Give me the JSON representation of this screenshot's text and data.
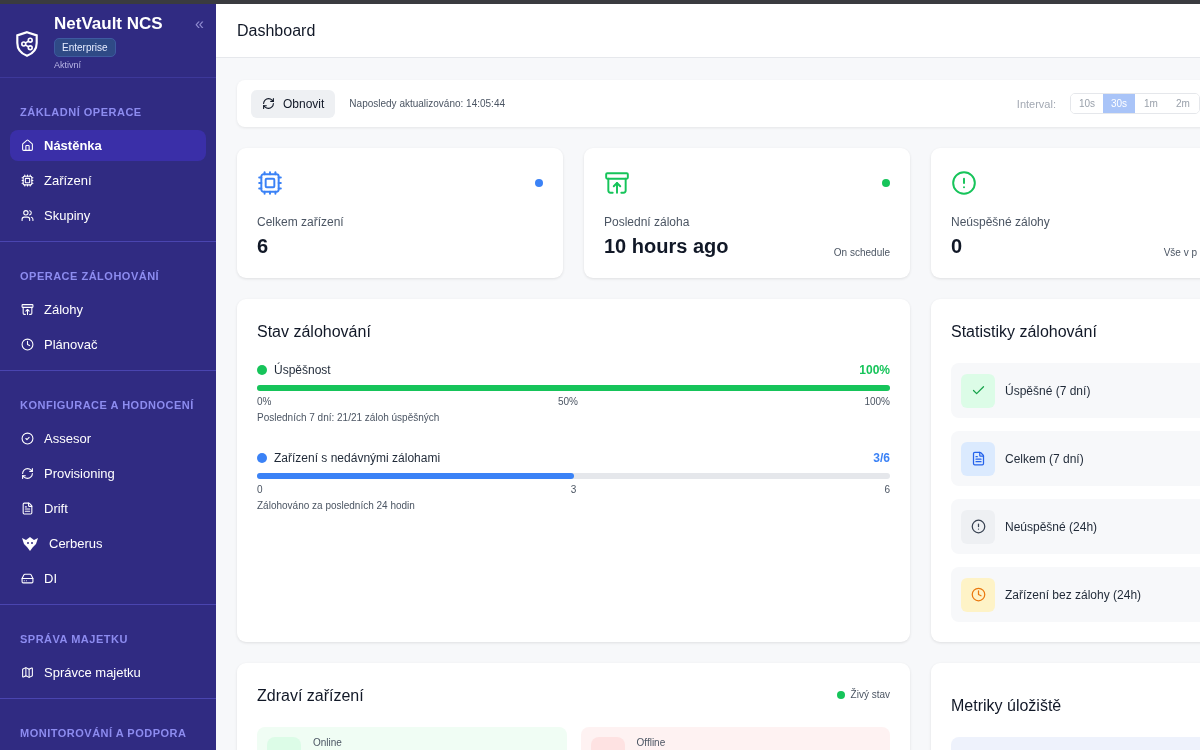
{
  "sidebar": {
    "brand": {
      "title": "NetVault NCS",
      "badge": "Enterprise",
      "status": "Aktivní",
      "collapse": "«"
    },
    "sections": [
      {
        "title": "ZÁKLADNÍ OPERACE",
        "items": [
          {
            "label": "Nástěnka",
            "selected": true
          },
          {
            "label": "Zařízení",
            "selected": false
          },
          {
            "label": "Skupiny",
            "selected": false
          }
        ]
      },
      {
        "title": "OPERACE ZÁLOHOVÁNÍ",
        "items": [
          {
            "label": "Zálohy",
            "selected": false
          },
          {
            "label": "Plánovač",
            "selected": false
          }
        ]
      },
      {
        "title": "KONFIGURACE A HODNOCENÍ",
        "items": [
          {
            "label": "Assesor",
            "selected": false
          },
          {
            "label": "Provisioning",
            "selected": false
          },
          {
            "label": "Drift",
            "selected": false
          },
          {
            "label": "Cerberus",
            "selected": false
          },
          {
            "label": "DI",
            "selected": false
          }
        ]
      },
      {
        "title": "SPRÁVA MAJETKU",
        "items": [
          {
            "label": "Správce majetku",
            "selected": false
          }
        ]
      },
      {
        "title": "MONITOROVÁNÍ A PODPORA"
      }
    ]
  },
  "header": {
    "title": "Dashboard"
  },
  "toolbar": {
    "refresh": "Obnovit",
    "updated": "Naposledy aktualizováno: 14:05:44",
    "interval_label": "Interval:",
    "intervals": [
      {
        "label": "10s",
        "selected": false
      },
      {
        "label": "30s",
        "selected": true
      },
      {
        "label": "1m",
        "selected": false
      },
      {
        "label": "2m",
        "selected": false
      }
    ]
  },
  "stat_cards": [
    {
      "label": "Celkem zařízení",
      "value": "6",
      "color": "#3b82f6"
    },
    {
      "label": "Poslední záloha",
      "value": "10 hours ago",
      "note": "On schedule",
      "color": "#16c45a"
    },
    {
      "label": "Neúspěšné zálohy",
      "value": "0",
      "note": "Vše v p"
    }
  ],
  "backup_status": {
    "title": "Stav zálohování",
    "metrics": [
      {
        "label": "Úspěšnost",
        "value": "100%",
        "color": "#16c45a",
        "level": 1,
        "ticks": [
          "0%",
          "50%",
          "100%"
        ],
        "note": "Posledních 7 dní: 21/21 záloh úspěšných"
      },
      {
        "label": "Zařízení s nedávnými zálohami",
        "value": "3/6",
        "color": "#3b82f6",
        "level": 0.5,
        "ticks": [
          "0",
          "3",
          "6"
        ],
        "note": "Zálohováno za posledních 24 hodin"
      }
    ]
  },
  "backup_stats": {
    "title": "Statistiky zálohování",
    "rows": [
      {
        "kind": "success",
        "label": "Úspěšné (7 dní)"
      },
      {
        "kind": "total",
        "label": "Celkem (7 dní)"
      },
      {
        "kind": "failed",
        "label": "Neúspěšné (24h)"
      },
      {
        "kind": "missing",
        "label": "Zařízení bez zálohy (24h)"
      }
    ]
  },
  "device_health": {
    "title": "Zdraví zařízení",
    "live": "Živý stav",
    "tiles": [
      {
        "kind": "online",
        "label": "Online"
      },
      {
        "kind": "offline",
        "label": "Offline"
      }
    ]
  },
  "storage_metrics": {
    "title": "Metriky úložiště"
  }
}
